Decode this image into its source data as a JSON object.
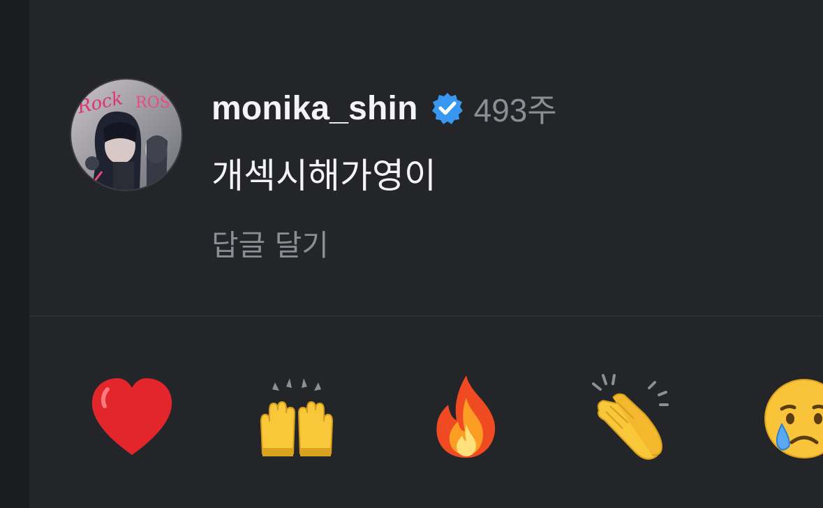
{
  "comment": {
    "username": "monika_shin",
    "verified_icon": "verified-badge-icon",
    "age": "493주",
    "text": "개섹시해가영이",
    "reply_label": "답글 달기"
  },
  "reactions": [
    {
      "icon": "red-heart-icon"
    },
    {
      "icon": "raising-hands-icon"
    },
    {
      "icon": "fire-icon"
    },
    {
      "icon": "clapping-hands-icon"
    },
    {
      "icon": "crying-face-icon"
    }
  ],
  "colors": {
    "background": "#242529",
    "username": "#f4f4f5",
    "muted": "#8c8e94",
    "verified": "#3897f0"
  }
}
